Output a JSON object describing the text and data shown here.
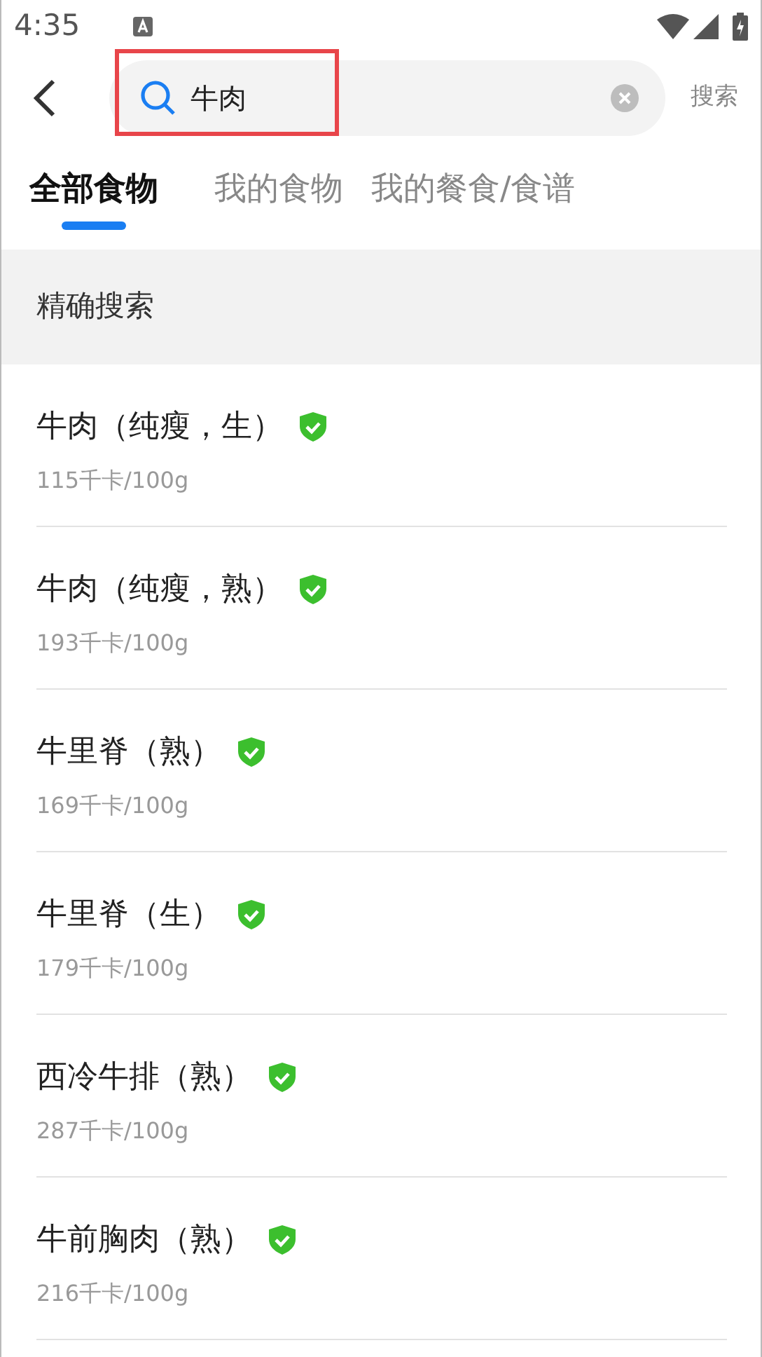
{
  "status_bar": {
    "time": "4:35"
  },
  "search": {
    "value": "牛肉",
    "highlighted": true,
    "action": "搜索"
  },
  "tabs": [
    {
      "label": "全部食物",
      "selected": true
    },
    {
      "label": "我的食物",
      "selected": false
    },
    {
      "label": "我的餐食/食谱",
      "selected": false
    }
  ],
  "section_title": "精确搜索",
  "foods": [
    {
      "name": "牛肉（纯瘦，生）",
      "verified": true,
      "calories": "115千卡/100g"
    },
    {
      "name": "牛肉（纯瘦，熟）",
      "verified": true,
      "calories": "193千卡/100g"
    },
    {
      "name": "牛里脊（熟）",
      "verified": true,
      "calories": "169千卡/100g"
    },
    {
      "name": "牛里脊（生）",
      "verified": true,
      "calories": "179千卡/100g"
    },
    {
      "name": "西冷牛排（熟）",
      "verified": true,
      "calories": "287千卡/100g"
    },
    {
      "name": "牛前胸肉（熟）",
      "verified": true,
      "calories": "216千卡/100g"
    }
  ]
}
